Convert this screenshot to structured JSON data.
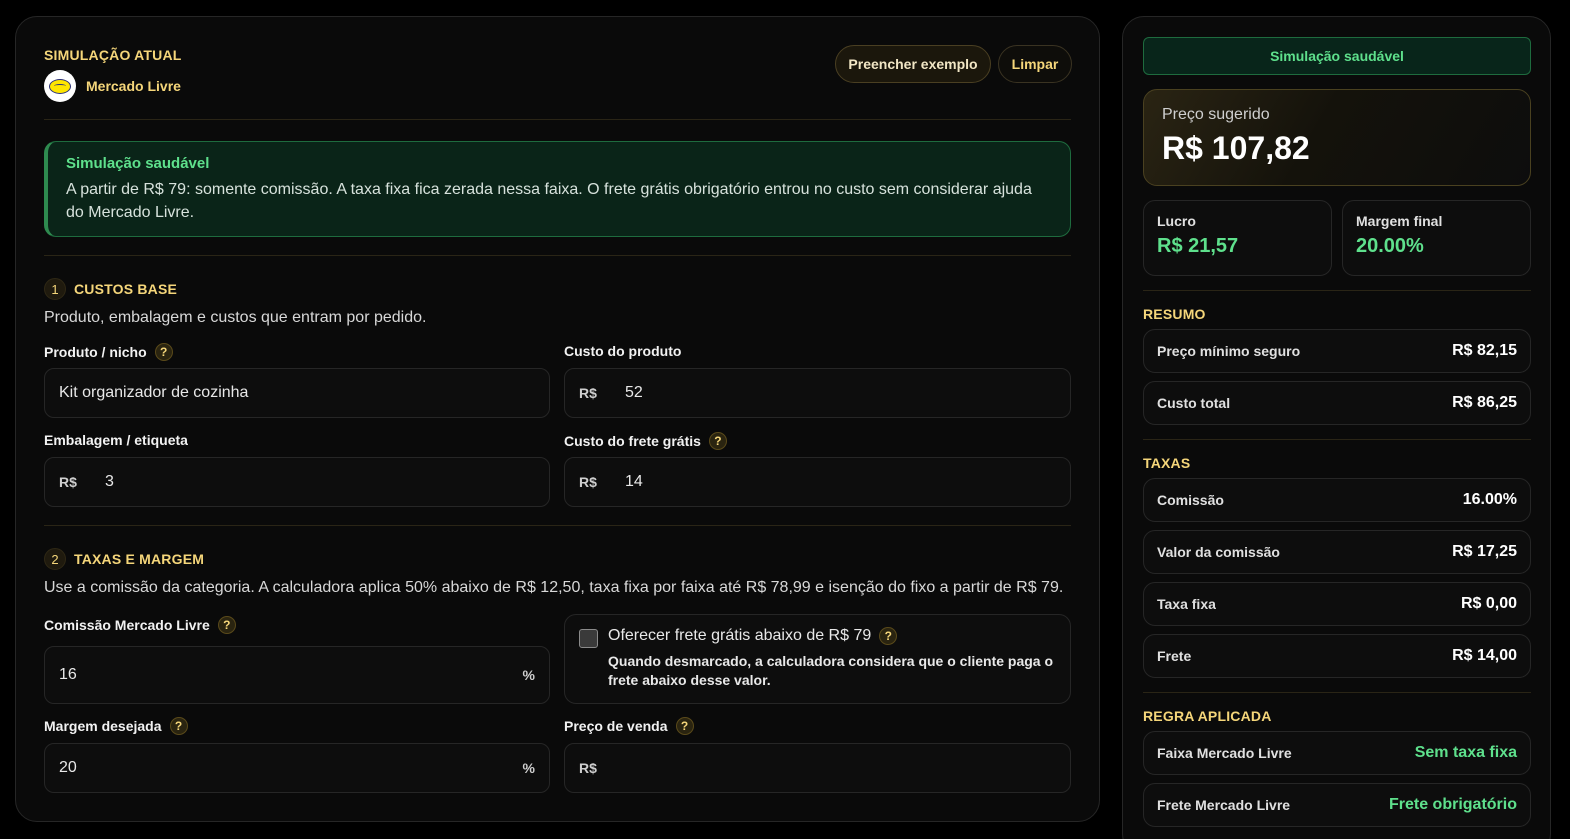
{
  "header": {
    "section_label": "SIMULAÇÃO ATUAL",
    "marketplace": "Mercado Livre",
    "example_button": "Preencher exemplo",
    "clear_button": "Limpar"
  },
  "alert": {
    "title": "Simulação saudável",
    "text": "A partir de R$ 79: somente comissão. A taxa fixa fica zerada nessa faixa. O frete grátis obrigatório entrou no custo sem considerar ajuda do Mercado Livre."
  },
  "base_costs": {
    "number": "1",
    "title": "CUSTOS BASE",
    "description": "Produto, embalagem e custos que entram por pedido.",
    "product_label": "Produto / nicho",
    "product_value": "Kit organizador de cozinha",
    "cost_label": "Custo do produto",
    "cost_prefix": "R$",
    "cost_value": "52",
    "packaging_label": "Embalagem / etiqueta",
    "packaging_prefix": "R$",
    "packaging_value": "3",
    "shipping_label": "Custo do frete grátis",
    "shipping_prefix": "R$",
    "shipping_value": "14"
  },
  "fees": {
    "number": "2",
    "title": "TAXAS E MARGEM",
    "description": "Use a comissão da categoria. A calculadora aplica 50% abaixo de R$ 12,50, taxa fixa por faixa até R$ 78,99 e isenção do fixo a partir de R$ 79.",
    "commission_label": "Comissão Mercado Livre",
    "commission_value": "16",
    "commission_suffix": "%",
    "free_shipping_label": "Oferecer frete grátis abaixo de R$ 79",
    "free_shipping_checked": false,
    "free_shipping_note": "Quando desmarcado, a calculadora considera que o cliente paga o frete abaixo desse valor.",
    "margin_label": "Margem desejada",
    "margin_value": "20",
    "margin_suffix": "%",
    "sale_price_label": "Preço de venda",
    "sale_price_prefix": "R$",
    "sale_price_value": ""
  },
  "summary_panel": {
    "status": "Simulação saudável",
    "suggested_price_label": "Preço sugerido",
    "suggested_price": "R$ 107,82",
    "profit_label": "Lucro",
    "profit_value": "R$ 21,57",
    "margin_label": "Margem final",
    "margin_value": "20.00%",
    "summary_title": "RESUMO",
    "summary_rows": [
      {
        "label": "Preço mínimo seguro",
        "value": "R$ 82,15"
      },
      {
        "label": "Custo total",
        "value": "R$ 86,25"
      }
    ],
    "fees_title": "TAXAS",
    "fee_rows": [
      {
        "label": "Comissão",
        "value": "16.00%"
      },
      {
        "label": "Valor da comissão",
        "value": "R$ 17,25"
      },
      {
        "label": "Taxa fixa",
        "value": "R$ 0,00"
      },
      {
        "label": "Frete",
        "value": "R$ 14,00"
      }
    ],
    "rule_title": "REGRA APLICADA",
    "rule_rows": [
      {
        "label": "Faixa Mercado Livre",
        "value": "Sem taxa fixa"
      },
      {
        "label": "Frete Mercado Livre",
        "value": "Frete obrigatório"
      }
    ]
  },
  "colors": {
    "accent_gold": "#f5d67a",
    "success_green": "#5ee08c",
    "background": "#000000"
  }
}
